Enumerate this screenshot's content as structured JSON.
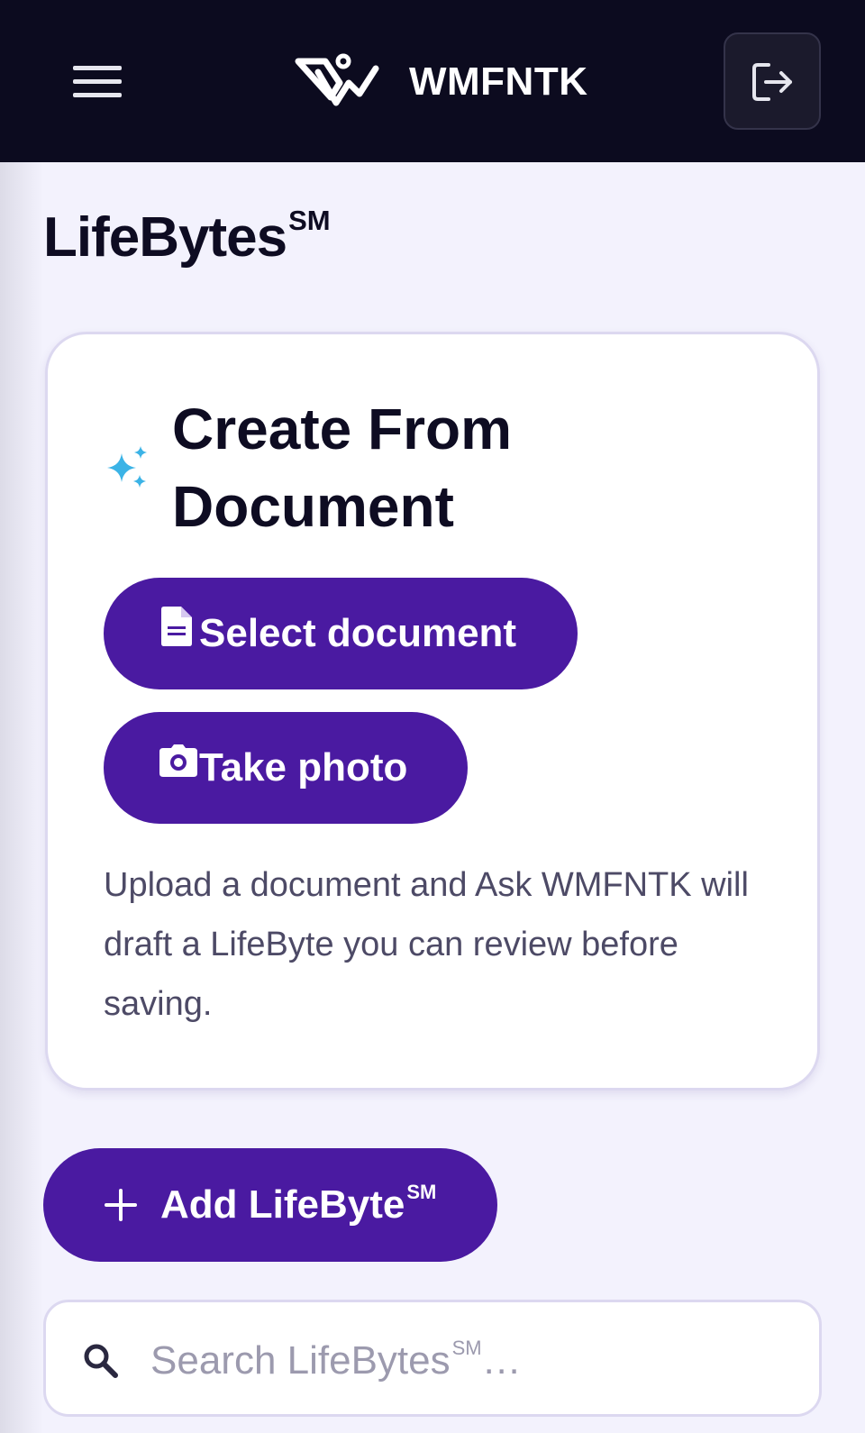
{
  "header": {
    "brand": "WMFNTK",
    "menu_icon": "hamburger-menu-icon",
    "logout_icon": "logout-icon",
    "logo_icon": "brand-logo-icon"
  },
  "page": {
    "title": "LifeBytes",
    "title_mark": "SM"
  },
  "create_card": {
    "icon": "sparkles-icon",
    "title_line1": "Create From",
    "title_line2": "Document",
    "select_document_label": "Select document",
    "select_document_icon": "file-icon",
    "take_photo_label": "Take photo",
    "take_photo_icon": "camera-icon",
    "description": "Upload a document and Ask WMFNTK will draft a LifeByte you can review before saving."
  },
  "add_button": {
    "label": "Add LifeByte",
    "mark": "SM",
    "icon": "plus-icon"
  },
  "search": {
    "placeholder": "Search LifeBytes",
    "placeholder_mark": "SM",
    "placeholder_suffix": "…",
    "icon": "search-icon"
  },
  "colors": {
    "header_bg": "#0c0b1f",
    "accent": "#4a1aa1",
    "page_bg": "#f3f2fd",
    "sparkle": "#3bb3e6"
  }
}
